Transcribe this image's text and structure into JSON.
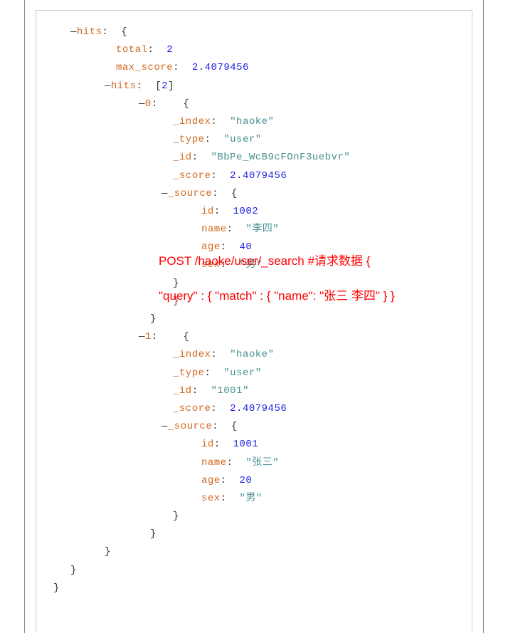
{
  "lines": [
    {
      "indent": 24,
      "parts": [
        {
          "c": "toggle",
          "t": "—"
        },
        {
          "c": "key",
          "t": "hits"
        },
        {
          "c": "punct",
          "t": ":  {"
        }
      ]
    },
    {
      "indent": 88,
      "parts": [
        {
          "c": "key",
          "t": "total"
        },
        {
          "c": "punct",
          "t": ":  "
        },
        {
          "c": "number",
          "t": "2"
        }
      ]
    },
    {
      "indent": 88,
      "parts": [
        {
          "c": "key",
          "t": "max_score"
        },
        {
          "c": "punct",
          "t": ":  "
        },
        {
          "c": "number",
          "t": "2.4079456"
        }
      ]
    },
    {
      "indent": 72,
      "parts": [
        {
          "c": "toggle",
          "t": "—"
        },
        {
          "c": "key",
          "t": "hits"
        },
        {
          "c": "punct",
          "t": ":  ["
        },
        {
          "c": "number",
          "t": "2"
        },
        {
          "c": "punct",
          "t": "]"
        }
      ]
    },
    {
      "indent": 120,
      "parts": [
        {
          "c": "toggle",
          "t": "—"
        },
        {
          "c": "key",
          "t": "0"
        },
        {
          "c": "punct",
          "t": ":    {"
        }
      ]
    },
    {
      "indent": 168,
      "parts": [
        {
          "c": "key",
          "t": "_index"
        },
        {
          "c": "punct",
          "t": ":  "
        },
        {
          "c": "string",
          "t": "\"haoke\""
        }
      ]
    },
    {
      "indent": 168,
      "parts": [
        {
          "c": "key",
          "t": "_type"
        },
        {
          "c": "punct",
          "t": ":  "
        },
        {
          "c": "string",
          "t": "\"user\""
        }
      ]
    },
    {
      "indent": 168,
      "parts": [
        {
          "c": "key",
          "t": "_id"
        },
        {
          "c": "punct",
          "t": ":  "
        },
        {
          "c": "string",
          "t": "\"BbPe_WcB9cFOnF3uebvr\""
        }
      ]
    },
    {
      "indent": 168,
      "parts": [
        {
          "c": "key",
          "t": "_score"
        },
        {
          "c": "punct",
          "t": ":  "
        },
        {
          "c": "number",
          "t": "2.4079456"
        }
      ]
    },
    {
      "indent": 152,
      "parts": [
        {
          "c": "toggle",
          "t": "—"
        },
        {
          "c": "key",
          "t": "_source"
        },
        {
          "c": "punct",
          "t": ":  {"
        }
      ]
    },
    {
      "indent": 208,
      "parts": [
        {
          "c": "key",
          "t": "id"
        },
        {
          "c": "punct",
          "t": ":  "
        },
        {
          "c": "number",
          "t": "1002"
        }
      ]
    },
    {
      "indent": 208,
      "parts": [
        {
          "c": "key",
          "t": "name"
        },
        {
          "c": "punct",
          "t": ":  "
        },
        {
          "c": "string",
          "t": "\"李四\""
        }
      ]
    },
    {
      "indent": 208,
      "parts": [
        {
          "c": "key",
          "t": "age"
        },
        {
          "c": "punct",
          "t": ":  "
        },
        {
          "c": "number",
          "t": "40"
        }
      ]
    },
    {
      "indent": 208,
      "parts": [
        {
          "c": "key",
          "t": "sex"
        },
        {
          "c": "punct",
          "t": ":  "
        },
        {
          "c": "string",
          "t": "\"男\""
        }
      ]
    },
    {
      "indent": 168,
      "parts": [
        {
          "c": "punct",
          "t": "}"
        }
      ]
    },
    {
      "indent": 168,
      "parts": [
        {
          "c": "brace",
          "t": "}"
        }
      ]
    },
    {
      "indent": 136,
      "parts": [
        {
          "c": "punct",
          "t": "}"
        }
      ]
    },
    {
      "indent": 120,
      "parts": [
        {
          "c": "toggle",
          "t": "—"
        },
        {
          "c": "key",
          "t": "1"
        },
        {
          "c": "punct",
          "t": ":    {"
        }
      ]
    },
    {
      "indent": 168,
      "parts": [
        {
          "c": "key",
          "t": "_index"
        },
        {
          "c": "punct",
          "t": ":  "
        },
        {
          "c": "string",
          "t": "\"haoke\""
        }
      ]
    },
    {
      "indent": 168,
      "parts": [
        {
          "c": "key",
          "t": "_type"
        },
        {
          "c": "punct",
          "t": ":  "
        },
        {
          "c": "string",
          "t": "\"user\""
        }
      ]
    },
    {
      "indent": 168,
      "parts": [
        {
          "c": "key",
          "t": "_id"
        },
        {
          "c": "punct",
          "t": ":  "
        },
        {
          "c": "string",
          "t": "\"1001\""
        }
      ]
    },
    {
      "indent": 168,
      "parts": [
        {
          "c": "key",
          "t": "_score"
        },
        {
          "c": "punct",
          "t": ":  "
        },
        {
          "c": "number",
          "t": "2.4079456"
        }
      ]
    },
    {
      "indent": 152,
      "parts": [
        {
          "c": "toggle",
          "t": "—"
        },
        {
          "c": "key",
          "t": "_source"
        },
        {
          "c": "punct",
          "t": ":  {"
        }
      ]
    },
    {
      "indent": 208,
      "parts": [
        {
          "c": "key",
          "t": "id"
        },
        {
          "c": "punct",
          "t": ":  "
        },
        {
          "c": "number",
          "t": "1001"
        }
      ]
    },
    {
      "indent": 208,
      "parts": [
        {
          "c": "key",
          "t": "name"
        },
        {
          "c": "punct",
          "t": ":  "
        },
        {
          "c": "string",
          "t": "\"张三\""
        }
      ]
    },
    {
      "indent": 208,
      "parts": [
        {
          "c": "key",
          "t": "age"
        },
        {
          "c": "punct",
          "t": ":  "
        },
        {
          "c": "number",
          "t": "20"
        }
      ]
    },
    {
      "indent": 208,
      "parts": [
        {
          "c": "key",
          "t": "sex"
        },
        {
          "c": "punct",
          "t": ":  "
        },
        {
          "c": "string",
          "t": "\"男\""
        }
      ]
    },
    {
      "indent": 168,
      "parts": [
        {
          "c": "punct",
          "t": "}"
        }
      ]
    },
    {
      "indent": 136,
      "parts": [
        {
          "c": "punct",
          "t": "}"
        }
      ]
    },
    {
      "indent": 72,
      "parts": [
        {
          "c": "punct",
          "t": "}"
        }
      ]
    },
    {
      "indent": 24,
      "parts": [
        {
          "c": "punct",
          "t": "}"
        }
      ]
    },
    {
      "indent": 0,
      "parts": [
        {
          "c": "punct",
          "t": "}"
        }
      ]
    }
  ],
  "overlay": {
    "line1": "POST /haoke/user/_search #请求数据 {",
    "line2": "\"query\" : { \"match\" : { \"name\": \"张三 李四\" } }"
  }
}
